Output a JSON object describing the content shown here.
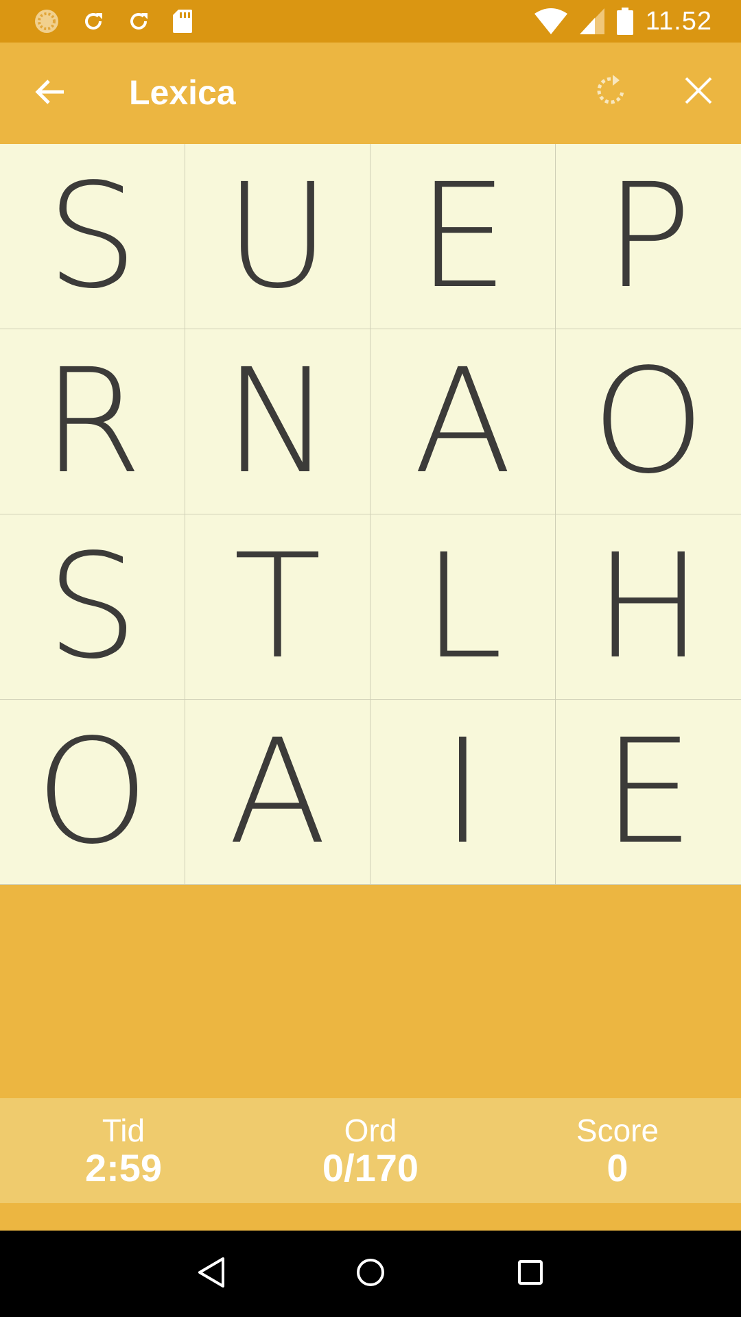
{
  "status_bar": {
    "time": "11.52",
    "icons": [
      "settings-loader-icon",
      "sync-icon",
      "sync-icon",
      "sd-card-icon",
      "wifi-icon",
      "signal-icon",
      "battery-icon"
    ]
  },
  "app_bar": {
    "title": "Lexica",
    "icons": [
      "arrow-back-icon",
      "refresh-icon",
      "close-icon"
    ]
  },
  "board": {
    "rows": [
      [
        "S",
        "U",
        "E",
        "P"
      ],
      [
        "R",
        "N",
        "A",
        "O"
      ],
      [
        "S",
        "T",
        "L",
        "H"
      ],
      [
        "O",
        "A",
        "I",
        "E"
      ]
    ]
  },
  "stats": {
    "time_label": "Tid",
    "time_value": "2:59",
    "words_label": "Ord",
    "words_value": "0/170",
    "score_label": "Score",
    "score_value": "0"
  },
  "nav_bar": {
    "icons": [
      "back-triangle-icon",
      "home-circle-icon",
      "recents-square-icon"
    ]
  },
  "colors": {
    "status_bar": "#da9612",
    "app_bar": "#ecb641",
    "board": "#f8f8da",
    "stats_bar": "#efcb6d",
    "letter": "#3c3b39"
  }
}
